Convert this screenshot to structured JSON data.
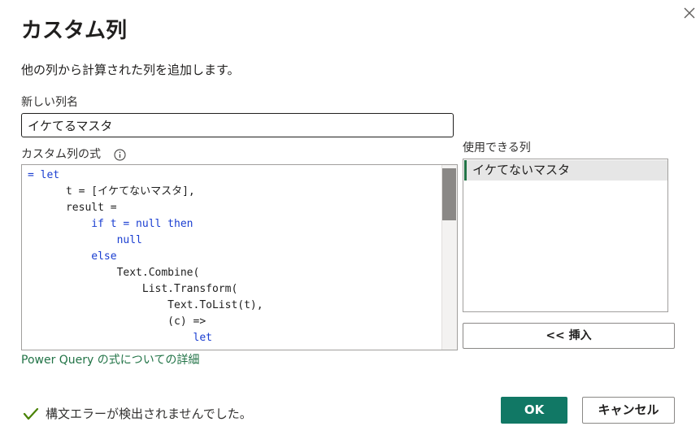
{
  "dialog": {
    "title": "カスタム列",
    "subtitle": "他の列から計算された列を追加します。",
    "close_label": "×"
  },
  "column_name": {
    "label": "新しい列名",
    "value": "イケてるマスタ"
  },
  "formula": {
    "label": "カスタム列の式",
    "info_icon": "info-icon",
    "lines": [
      "= let",
      "      t = [イケてないマスタ],",
      "      result =",
      "          if t = null then",
      "              null",
      "          else",
      "              Text.Combine(",
      "                  List.Transform(",
      "                      Text.ToList(t),",
      "                      (c) =>",
      "                          let"
    ]
  },
  "available_columns": {
    "label": "使用できる列",
    "items": [
      "イケてないマスタ"
    ]
  },
  "buttons": {
    "insert": "<< 挿入",
    "ok": "OK",
    "cancel": "キャンセル"
  },
  "help_link": "Power Query の式についての詳細",
  "status": {
    "icon": "checkmark-icon",
    "text": "構文エラーが検出されませんでした。"
  },
  "colors": {
    "accent": "#117865",
    "link": "#217346",
    "keyword": "#1a3ed1"
  }
}
